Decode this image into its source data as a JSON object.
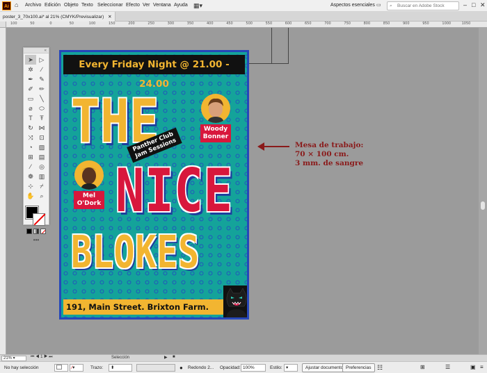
{
  "app": {
    "logo_text": "Ai",
    "menu": [
      "Archivo",
      "Edición",
      "Objeto",
      "Texto",
      "Seleccionar",
      "Efecto",
      "Ver",
      "Ventana",
      "Ayuda"
    ],
    "workspace": "Aspectos esenciales",
    "stock_placeholder": "Buscar en Adobe Stock"
  },
  "document": {
    "tab_title": "poster_3_70x100.ai* al 21% (CMYK/Previsualizar)"
  },
  "ruler": {
    "top_ticks": [
      "100",
      "50",
      "0",
      "50",
      "100",
      "150",
      "200",
      "250",
      "300",
      "350",
      "400",
      "450",
      "500",
      "550",
      "600",
      "650",
      "700",
      "750",
      "800",
      "850",
      "900",
      "950",
      "1000",
      "1050"
    ]
  },
  "tools": {
    "grip_label": "«",
    "more": "•••"
  },
  "poster": {
    "top_banner": "Every Friday Night @ 21.00 - 24.00",
    "word1": "THE",
    "word2": "NICE",
    "word3": "BLOKES",
    "tag": "Panther Club Jam Sessions",
    "person1": "Woody Bonner",
    "person2": "Mel O'Dork",
    "address": "191, Main Street. Brixton Farm.",
    "colors": {
      "frame": "#2647b9",
      "teal": "#14a39a",
      "yellow": "#f2b531",
      "red": "#d8173c"
    }
  },
  "annotation": {
    "line1": "Mesa de trabajo:",
    "line2": "70 × 100 cm.",
    "line3": "3 mm. de sangre",
    "color": "#8a1a1a"
  },
  "status": {
    "zoom": "21%",
    "tool": "Selección"
  },
  "control": {
    "selection": "No hay selección",
    "stroke_label": "Trazo:",
    "brush": "Redondo 2...",
    "opacity_label": "Opacidad:",
    "opacity": "100%",
    "style_label": "Estilo:",
    "doc_button": "Ajustar documento",
    "pref_button": "Preferencias"
  }
}
